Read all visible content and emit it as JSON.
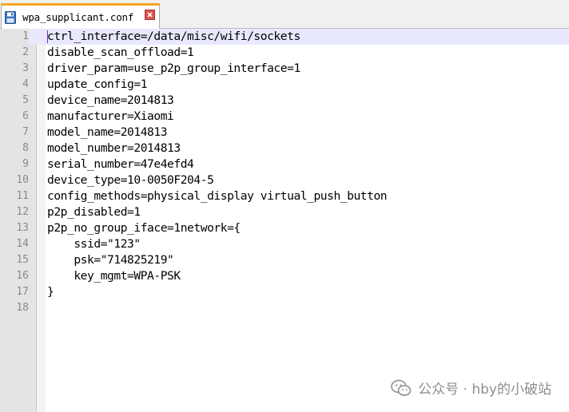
{
  "tab": {
    "filename": "wpa_supplicant.conf",
    "icon": "save-file-icon",
    "close_icon": "close-icon",
    "accent_color": "#f5a623"
  },
  "editor": {
    "current_line": 1,
    "lines": [
      {
        "number": "1",
        "text": "ctrl_interface=/data/misc/wifi/sockets"
      },
      {
        "number": "2",
        "text": "disable_scan_offload=1"
      },
      {
        "number": "3",
        "text": "driver_param=use_p2p_group_interface=1"
      },
      {
        "number": "4",
        "text": "update_config=1"
      },
      {
        "number": "5",
        "text": "device_name=2014813"
      },
      {
        "number": "6",
        "text": "manufacturer=Xiaomi"
      },
      {
        "number": "7",
        "text": "model_name=2014813"
      },
      {
        "number": "8",
        "text": "model_number=2014813"
      },
      {
        "number": "9",
        "text": "serial_number=47e4efd4"
      },
      {
        "number": "10",
        "text": "device_type=10-0050F204-5"
      },
      {
        "number": "11",
        "text": "config_methods=physical_display virtual_push_button"
      },
      {
        "number": "12",
        "text": "p2p_disabled=1"
      },
      {
        "number": "13",
        "text": "p2p_no_group_iface=1network={"
      },
      {
        "number": "14",
        "text": "    ssid=\"123\""
      },
      {
        "number": "15",
        "text": "    psk=\"714825219\""
      },
      {
        "number": "16",
        "text": "    key_mgmt=WPA-PSK"
      },
      {
        "number": "17",
        "text": "}"
      },
      {
        "number": "18",
        "text": ""
      }
    ]
  },
  "watermark": {
    "text": "公众号 · hby的小破站",
    "icon": "wechat-icon"
  }
}
